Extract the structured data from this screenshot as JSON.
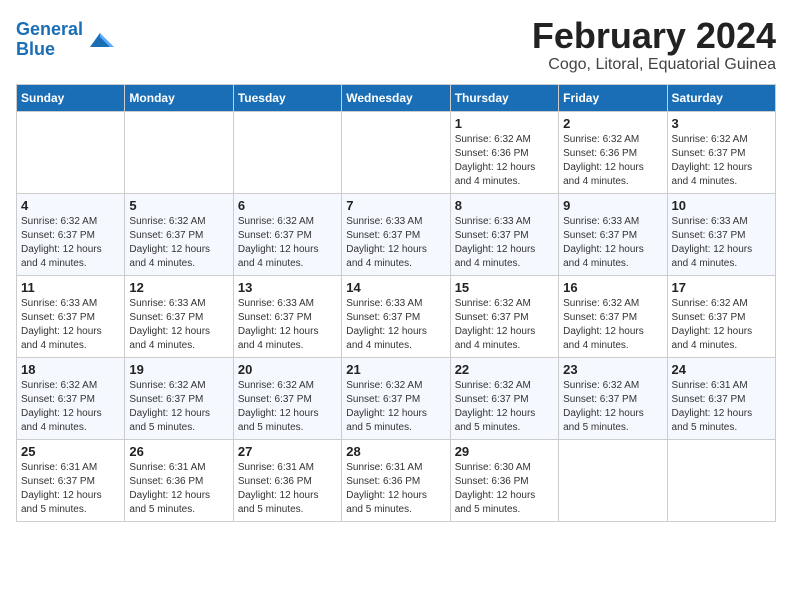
{
  "logo": {
    "text_general": "General",
    "text_blue": "Blue"
  },
  "title": "February 2024",
  "subtitle": "Cogo, Litoral, Equatorial Guinea",
  "days_of_week": [
    "Sunday",
    "Monday",
    "Tuesday",
    "Wednesday",
    "Thursday",
    "Friday",
    "Saturday"
  ],
  "weeks": [
    [
      {
        "day": "",
        "info": ""
      },
      {
        "day": "",
        "info": ""
      },
      {
        "day": "",
        "info": ""
      },
      {
        "day": "",
        "info": ""
      },
      {
        "day": "1",
        "info": "Sunrise: 6:32 AM\nSunset: 6:36 PM\nDaylight: 12 hours and 4 minutes."
      },
      {
        "day": "2",
        "info": "Sunrise: 6:32 AM\nSunset: 6:36 PM\nDaylight: 12 hours and 4 minutes."
      },
      {
        "day": "3",
        "info": "Sunrise: 6:32 AM\nSunset: 6:37 PM\nDaylight: 12 hours and 4 minutes."
      }
    ],
    [
      {
        "day": "4",
        "info": "Sunrise: 6:32 AM\nSunset: 6:37 PM\nDaylight: 12 hours and 4 minutes."
      },
      {
        "day": "5",
        "info": "Sunrise: 6:32 AM\nSunset: 6:37 PM\nDaylight: 12 hours and 4 minutes."
      },
      {
        "day": "6",
        "info": "Sunrise: 6:32 AM\nSunset: 6:37 PM\nDaylight: 12 hours and 4 minutes."
      },
      {
        "day": "7",
        "info": "Sunrise: 6:33 AM\nSunset: 6:37 PM\nDaylight: 12 hours and 4 minutes."
      },
      {
        "day": "8",
        "info": "Sunrise: 6:33 AM\nSunset: 6:37 PM\nDaylight: 12 hours and 4 minutes."
      },
      {
        "day": "9",
        "info": "Sunrise: 6:33 AM\nSunset: 6:37 PM\nDaylight: 12 hours and 4 minutes."
      },
      {
        "day": "10",
        "info": "Sunrise: 6:33 AM\nSunset: 6:37 PM\nDaylight: 12 hours and 4 minutes."
      }
    ],
    [
      {
        "day": "11",
        "info": "Sunrise: 6:33 AM\nSunset: 6:37 PM\nDaylight: 12 hours and 4 minutes."
      },
      {
        "day": "12",
        "info": "Sunrise: 6:33 AM\nSunset: 6:37 PM\nDaylight: 12 hours and 4 minutes."
      },
      {
        "day": "13",
        "info": "Sunrise: 6:33 AM\nSunset: 6:37 PM\nDaylight: 12 hours and 4 minutes."
      },
      {
        "day": "14",
        "info": "Sunrise: 6:33 AM\nSunset: 6:37 PM\nDaylight: 12 hours and 4 minutes."
      },
      {
        "day": "15",
        "info": "Sunrise: 6:32 AM\nSunset: 6:37 PM\nDaylight: 12 hours and 4 minutes."
      },
      {
        "day": "16",
        "info": "Sunrise: 6:32 AM\nSunset: 6:37 PM\nDaylight: 12 hours and 4 minutes."
      },
      {
        "day": "17",
        "info": "Sunrise: 6:32 AM\nSunset: 6:37 PM\nDaylight: 12 hours and 4 minutes."
      }
    ],
    [
      {
        "day": "18",
        "info": "Sunrise: 6:32 AM\nSunset: 6:37 PM\nDaylight: 12 hours and 4 minutes."
      },
      {
        "day": "19",
        "info": "Sunrise: 6:32 AM\nSunset: 6:37 PM\nDaylight: 12 hours and 5 minutes."
      },
      {
        "day": "20",
        "info": "Sunrise: 6:32 AM\nSunset: 6:37 PM\nDaylight: 12 hours and 5 minutes."
      },
      {
        "day": "21",
        "info": "Sunrise: 6:32 AM\nSunset: 6:37 PM\nDaylight: 12 hours and 5 minutes."
      },
      {
        "day": "22",
        "info": "Sunrise: 6:32 AM\nSunset: 6:37 PM\nDaylight: 12 hours and 5 minutes."
      },
      {
        "day": "23",
        "info": "Sunrise: 6:32 AM\nSunset: 6:37 PM\nDaylight: 12 hours and 5 minutes."
      },
      {
        "day": "24",
        "info": "Sunrise: 6:31 AM\nSunset: 6:37 PM\nDaylight: 12 hours and 5 minutes."
      }
    ],
    [
      {
        "day": "25",
        "info": "Sunrise: 6:31 AM\nSunset: 6:37 PM\nDaylight: 12 hours and 5 minutes."
      },
      {
        "day": "26",
        "info": "Sunrise: 6:31 AM\nSunset: 6:36 PM\nDaylight: 12 hours and 5 minutes."
      },
      {
        "day": "27",
        "info": "Sunrise: 6:31 AM\nSunset: 6:36 PM\nDaylight: 12 hours and 5 minutes."
      },
      {
        "day": "28",
        "info": "Sunrise: 6:31 AM\nSunset: 6:36 PM\nDaylight: 12 hours and 5 minutes."
      },
      {
        "day": "29",
        "info": "Sunrise: 6:30 AM\nSunset: 6:36 PM\nDaylight: 12 hours and 5 minutes."
      },
      {
        "day": "",
        "info": ""
      },
      {
        "day": "",
        "info": ""
      }
    ]
  ]
}
